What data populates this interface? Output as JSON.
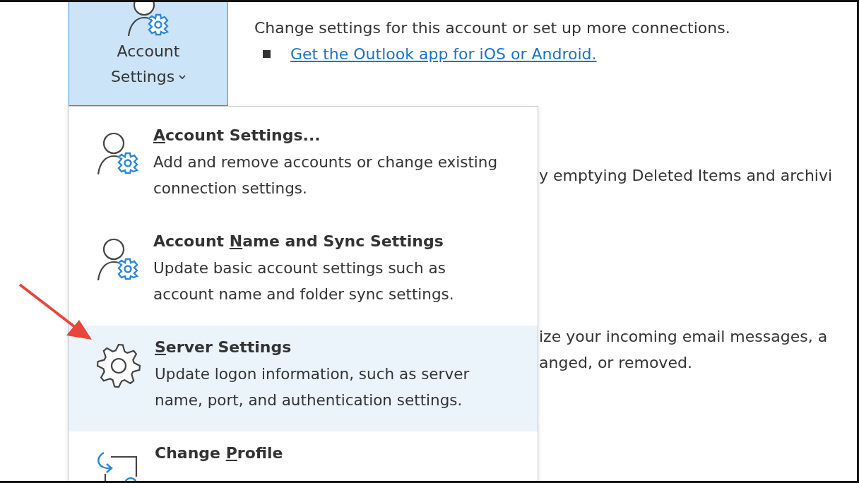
{
  "ribbon_button": {
    "label_line1": "Account",
    "label_line2": "Settings",
    "selected": true
  },
  "main": {
    "description": "Change settings for this account or set up more connections.",
    "link": "Get the Outlook app for iOS or Android.",
    "partial_lines": [
      {
        "text": "y emptying Deleted Items and archivi"
      },
      {
        "text": "ize your incoming email messages, a"
      },
      {
        "text": "anged, or removed."
      }
    ]
  },
  "menu": {
    "items": [
      {
        "kind": "person",
        "key": "A",
        "after": "ccount Settings...",
        "description": "Add and remove accounts or change existing connection settings.",
        "selected": false
      },
      {
        "kind": "person",
        "before": "Account ",
        "key": "N",
        "after": "ame and Sync Settings",
        "description": "Update basic account settings such as account name and folder sync settings.",
        "selected": false
      },
      {
        "kind": "server",
        "key": "S",
        "after": "erver Settings",
        "description": "Update logon information, such as server name, port, and authentication settings.",
        "selected": true
      },
      {
        "kind": "profile",
        "before": "Change ",
        "key": "P",
        "after": "rofile",
        "selected": false
      }
    ]
  }
}
